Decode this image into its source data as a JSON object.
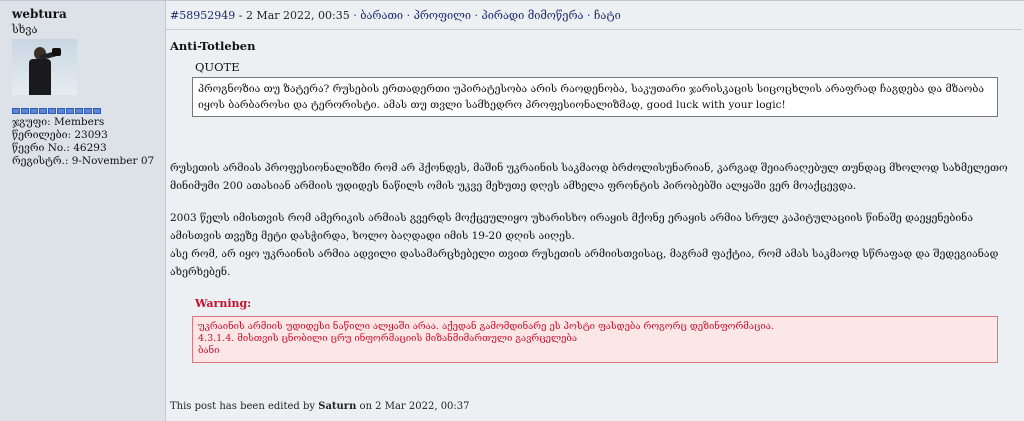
{
  "author": {
    "username": "webtura",
    "title": "სხვა",
    "rank_pips": 10,
    "group": "ჯგუფი: Members",
    "posts": "წერილები: 23093",
    "member_no": "წევრი No.: 46293",
    "registered": "რეგისტრ.: 9-November 07"
  },
  "post": {
    "id_link": "#58952949",
    "date": "2 Mar 2022, 00:35",
    "links": [
      "ბარათი",
      "პროფილი",
      "პირადი მიმოწერა",
      "ჩატი"
    ],
    "quote": {
      "author": "Anti-Totleben",
      "label": "QUOTE",
      "text": "პროგნოზია თუ ზატერა? რუსების ერთადერთი უპირატესობა არის რაოდენობა, საკუთარი ჯარისკაცის სიცოცხლის არაფრად ჩაგდება და მზაობა იყოს ბარბაროსი და ტერორისტი. ამას თუ თვლი სამხედრო პროფესიონალიზმად, good luck with your logic!"
    },
    "paragraph1": "რუსეთის არმიას პროფესიონალიზმი რომ არ ჰქონდეს, მაშინ უკრაინის საკმაოდ ბრძოლისუნარიან, კარგად შეიარაღებულ თუნდაც მხოლოდ სახმელეთო მინიმუმი 200 ათასიან არმიის უდიდეს ნაწილს ომის უკვე მეხუთე დღეს ამხელა ფრონტის პირობებში ალყაში ვერ მოაქცევდა.",
    "paragraph2": "2003 წელს იმისთვის რომ ამერიკის არმიას გვერდს მოქცეულიყო უხარისხო ირაყის მქონე ერაყის არმია სრულ კაპიტულაციის წინაშე დაეყენებინა ამისთვის თვეზე მეტი დასჭირდა, ხოლო ბაღდადი იმის 19-20 დღის აიღეს.",
    "paragraph3": "ასე რომ, არ იყო უკრაინის არმია ადვილი დასამარცხებელი თვით რუსეთის არმიისთვისაც, მაგრამ ფაქტია, რომ ამას საკმაოდ სწრაფად და შედეგიანად ახერხებენ.",
    "warning": {
      "label": "Warning:",
      "line1": "უკრაინის არმიის უდიდესი ნაწილი ალყაში არაა. აქედან გამომდინარე ეს პოსტი ფასდება როგორც დეზინფორმაცია.",
      "line2": "4.3.1.4. მისთვის ცნობილი ცრუ ინფორმაციის მიზანმიმართული გავრცელება",
      "line3": "ბანი"
    },
    "edited": {
      "prefix": "This post has been edited by",
      "editor": "Saturn",
      "suffix": "on 2 Mar 2022, 00:37"
    }
  },
  "colors": {
    "link": "#1a2a6c",
    "warning": "#c8102e",
    "warning_bg": "#fde6e6",
    "pip": "#5c85d6"
  }
}
